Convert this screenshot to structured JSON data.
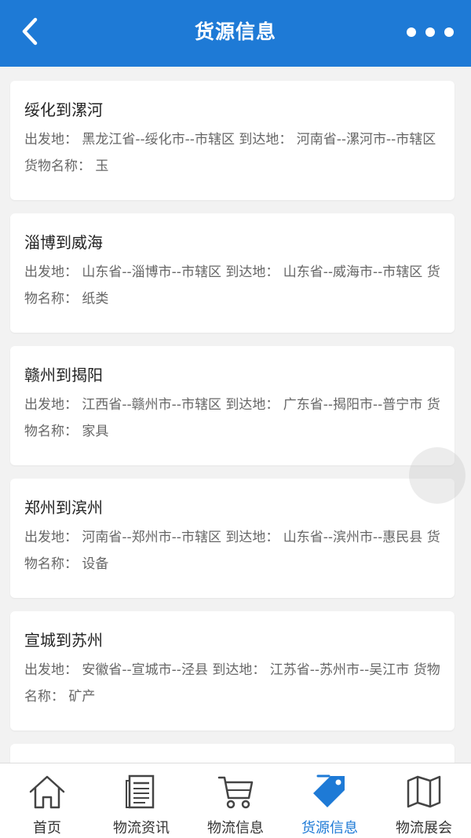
{
  "header": {
    "title": "货源信息",
    "back_icon": "chevron-left-icon",
    "more_icon": "more-dots-icon"
  },
  "cards": [
    {
      "title": "绥化到漯河",
      "desc": "出发地： 黑龙江省--绥化市--市辖区 到达地： 河南省--漯河市--市辖区 货物名称： 玉"
    },
    {
      "title": "淄博到威海",
      "desc": "出发地： 山东省--淄博市--市辖区 到达地： 山东省--威海市--市辖区 货物名称： 纸类"
    },
    {
      "title": "赣州到揭阳",
      "desc": "出发地： 江西省--赣州市--市辖区 到达地： 广东省--揭阳市--普宁市 货物名称： 家具"
    },
    {
      "title": "郑州到滨州",
      "desc": "出发地： 河南省--郑州市--市辖区 到达地： 山东省--滨州市--惠民县 货物名称： 设备"
    },
    {
      "title": "宣城到苏州",
      "desc": "出发地： 安徽省--宣城市--泾县 到达地： 江苏省--苏州市--吴江市 货物名称： 矿产"
    }
  ],
  "tabbar": {
    "items": [
      {
        "label": "首页",
        "icon": "home-icon"
      },
      {
        "label": "物流资讯",
        "icon": "newspaper-icon"
      },
      {
        "label": "物流信息",
        "icon": "cart-icon"
      },
      {
        "label": "货源信息",
        "icon": "tag-icon",
        "active": true
      },
      {
        "label": "物流展会",
        "icon": "map-icon"
      }
    ]
  },
  "colors": {
    "primary": "#1e7ad6",
    "background": "#f2f2f2",
    "card": "#ffffff",
    "text_dark": "#222222",
    "text_muted": "#666666"
  }
}
